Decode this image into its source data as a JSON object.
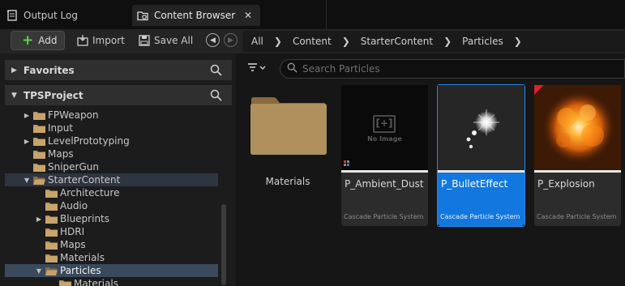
{
  "tabs": [
    {
      "label": "Output Log",
      "icon": "output-log-icon"
    },
    {
      "label": "Content Browser",
      "icon": "content-browser-icon",
      "close": "✕"
    }
  ],
  "toolbar": {
    "add_label": "Add",
    "import_label": "Import",
    "save_all_label": "Save All"
  },
  "breadcrumbs": [
    "All",
    "Content",
    "StarterContent",
    "Particles"
  ],
  "sections": {
    "favorites": "Favorites",
    "project": "TPSProject"
  },
  "tree": [
    {
      "label": "FPWeapon",
      "indent": 1,
      "expander": "right"
    },
    {
      "label": "Input",
      "indent": 1,
      "expander": ""
    },
    {
      "label": "LevelPrototyping",
      "indent": 1,
      "expander": "right"
    },
    {
      "label": "Maps",
      "indent": 1,
      "expander": ""
    },
    {
      "label": "SniperGun",
      "indent": 1,
      "expander": ""
    },
    {
      "label": "StarterContent",
      "indent": 1,
      "expander": "down",
      "state": "highlighted"
    },
    {
      "label": "Architecture",
      "indent": 2,
      "expander": ""
    },
    {
      "label": "Audio",
      "indent": 2,
      "expander": ""
    },
    {
      "label": "Blueprints",
      "indent": 2,
      "expander": "right"
    },
    {
      "label": "HDRI",
      "indent": 2,
      "expander": ""
    },
    {
      "label": "Maps",
      "indent": 2,
      "expander": ""
    },
    {
      "label": "Materials",
      "indent": 2,
      "expander": ""
    },
    {
      "label": "Particles",
      "indent": 2,
      "expander": "down",
      "state": "selected"
    },
    {
      "label": "Materials",
      "indent": 3,
      "expander": ""
    }
  ],
  "search": {
    "placeholder": "Search Particles"
  },
  "assets": {
    "folder": {
      "name": "Materials"
    },
    "items": [
      {
        "name": "P_Ambient_Dust",
        "type": "Cascade Particle System",
        "no_image": "No Image",
        "no_image_glyph": "[+]"
      },
      {
        "name": "P_BulletEffect",
        "type": "Cascade Particle System",
        "selected": true
      },
      {
        "name": "P_Explosion",
        "type": "Cascade Particle System",
        "marked": true
      }
    ]
  },
  "colors": {
    "accent_blue": "#1278e0",
    "add_green": "#5fd04c",
    "folder_tan": "#b08c5a",
    "marker_red": "#e0202a"
  }
}
